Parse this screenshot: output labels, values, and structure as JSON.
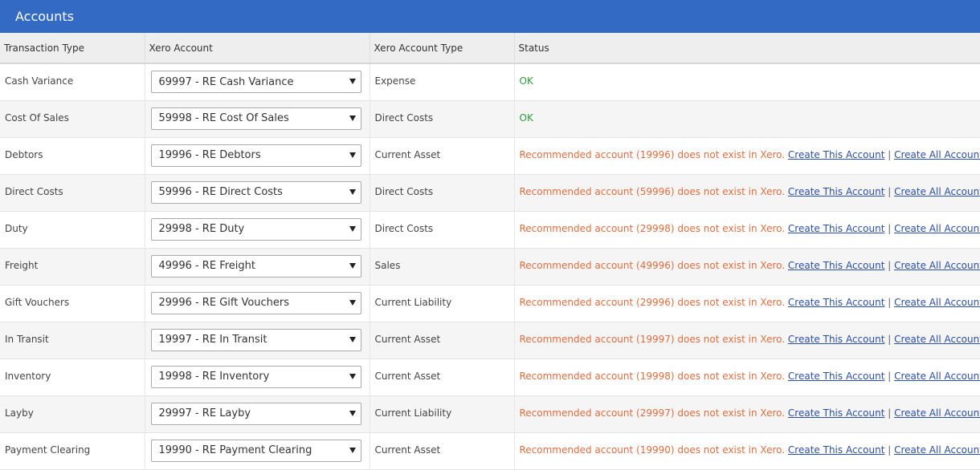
{
  "header": {
    "title": "Accounts"
  },
  "columns": [
    "Transaction Type",
    "Xero Account",
    "Xero Account Type",
    "Status"
  ],
  "rows": [
    {
      "type": "Cash Variance",
      "account": "69997 - RE Cash Variance",
      "account_type": "Expense",
      "status": "OK",
      "ok": true
    },
    {
      "type": "Cost Of Sales",
      "account": "59998 - RE Cost Of Sales",
      "account_type": "Direct Costs",
      "status": "OK",
      "ok": true
    },
    {
      "type": "Debtors",
      "account": "19996 - RE Debtors",
      "account_type": "Current Asset",
      "status": "Recommended account (19996) does not exist in Xero.",
      "ok": false
    },
    {
      "type": "Direct Costs",
      "account": "59996 - RE Direct Costs",
      "account_type": "Direct Costs",
      "status": "Recommended account (59996) does not exist in Xero.",
      "ok": false
    },
    {
      "type": "Duty",
      "account": "29998 - RE Duty",
      "account_type": "Direct Costs",
      "status": "Recommended account (29998) does not exist in Xero.",
      "ok": false
    },
    {
      "type": "Freight",
      "account": "49996 - RE Freight",
      "account_type": "Sales",
      "status": "Recommended account (49996) does not exist in Xero.",
      "ok": false
    },
    {
      "type": "Gift Vouchers",
      "account": "29996 - RE Gift Vouchers",
      "account_type": "Current Liability",
      "status": "Recommended account (29996) does not exist in Xero.",
      "ok": false
    },
    {
      "type": "In Transit",
      "account": "19997 - RE In Transit",
      "account_type": "Current Asset",
      "status": "Recommended account (19997) does not exist in Xero.",
      "ok": false
    },
    {
      "type": "Inventory",
      "account": "19998 - RE Inventory",
      "account_type": "Current Asset",
      "status": "Recommended account (19998) does not exist in Xero.",
      "ok": false
    },
    {
      "type": "Layby",
      "account": "29997 - RE Layby",
      "account_type": "Current Liability",
      "status": "Recommended account (29997) does not exist in Xero.",
      "ok": false
    },
    {
      "type": "Payment Clearing",
      "account": "19990 - RE Payment Clearing",
      "account_type": "Current Asset",
      "status": "Recommended account (19990) does not exist in Xero.",
      "ok": false
    }
  ],
  "actions": {
    "create_this": "Create This Account",
    "create_all": "Create All Accounts",
    "separator": "|"
  },
  "colors": {
    "header_bg": "#336ac4",
    "ok": "#2e9a3a",
    "warn": "#e06d3f",
    "link": "#2a4fa8"
  }
}
